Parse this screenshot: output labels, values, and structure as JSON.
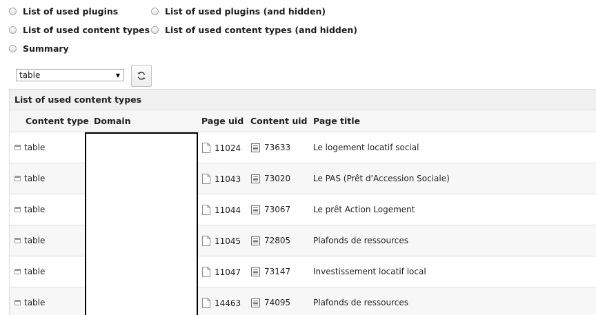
{
  "radio_options": [
    {
      "label": "List of used plugins"
    },
    {
      "label": "List of used plugins (and hidden)"
    },
    {
      "label": "List of used content types"
    },
    {
      "label": "List of used content types (and hidden)"
    },
    {
      "label": "Summary"
    }
  ],
  "filter": {
    "selected": "table"
  },
  "panel": {
    "title": "List of used content types"
  },
  "columns": [
    "Content type",
    "Domain",
    "Page uid",
    "Content uid",
    "Page title"
  ],
  "rows": [
    {
      "content_type": "table",
      "page_uid": "11024",
      "content_uid": "73633",
      "page_title": "Le logement locatif social"
    },
    {
      "content_type": "table",
      "page_uid": "11043",
      "content_uid": "73020",
      "page_title": "Le PAS (Prêt d'Accession Sociale)"
    },
    {
      "content_type": "table",
      "page_uid": "11044",
      "content_uid": "73067",
      "page_title": "Le prêt Action Logement"
    },
    {
      "content_type": "table",
      "page_uid": "11045",
      "content_uid": "72805",
      "page_title": "Plafonds de ressources"
    },
    {
      "content_type": "table",
      "page_uid": "11047",
      "content_uid": "73147",
      "page_title": "Investissement locatif local"
    },
    {
      "content_type": "table",
      "page_uid": "14463",
      "content_uid": "74095",
      "page_title": "Plafonds de ressources"
    }
  ]
}
